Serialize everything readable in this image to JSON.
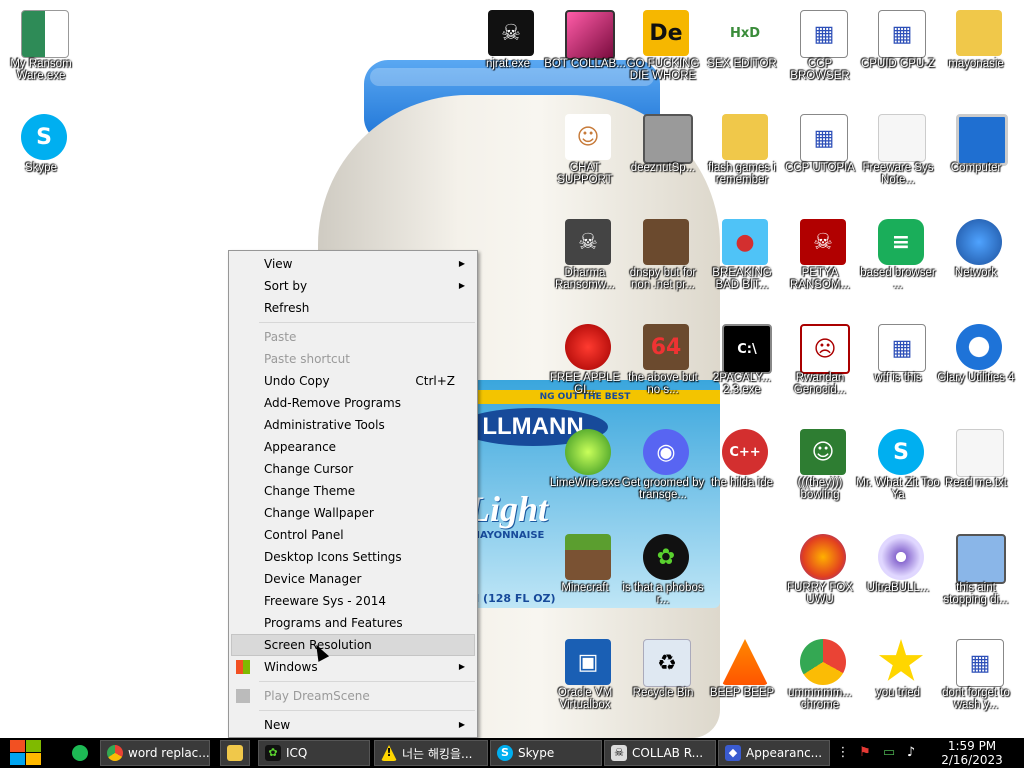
{
  "desktop": {
    "wallpaper": {
      "brand": "LLMANN",
      "band_text": "NG OUT THE BEST",
      "variant": "Light",
      "sub": "MAYONNAISE",
      "size": "N (128 FL OZ)"
    },
    "icons": [
      {
        "label": "My Ransom Ware.exe",
        "icon": "green-white-flag-icon"
      },
      {
        "label": "Skype",
        "icon": "skype-icon"
      },
      {
        "label": "njrat.exe",
        "icon": "skull-icon"
      },
      {
        "label": "BOT COLLAB...",
        "icon": "pink-monitor-icon"
      },
      {
        "label": "GO FUCKING DIE WHORE",
        "icon": "de-logo-icon"
      },
      {
        "label": "SEX EDITOR",
        "icon": "hxd-icon"
      },
      {
        "label": "CCP BROWSER",
        "icon": "document-icon"
      },
      {
        "label": "CPUID CPU-Z",
        "icon": "document-icon"
      },
      {
        "label": "mayonasie",
        "icon": "user-folder-icon"
      },
      {
        "label": "CHAT SUPPORT",
        "icon": "doctor-icon"
      },
      {
        "label": "deeznutSp...",
        "icon": "windows-stack-icon"
      },
      {
        "label": "flash games i remember",
        "icon": "folder-icon"
      },
      {
        "label": "CCP UTOPIA",
        "icon": "document-icon"
      },
      {
        "label": "Freeware Sys Note...",
        "icon": "blank-document-icon"
      },
      {
        "label": "Computer",
        "icon": "computer-icon"
      },
      {
        "label": "Dharma Ransomw...",
        "icon": "skull-helmet-icon"
      },
      {
        "label": "dnspy but for non .net pr...",
        "icon": "portrait-icon"
      },
      {
        "label": "BREAKING BAD BIT...",
        "icon": "angry-bird-icon"
      },
      {
        "label": "PETYA RANSOM...",
        "icon": "red-skull-icon"
      },
      {
        "label": "based browser ...",
        "icon": "green-chat-icon"
      },
      {
        "label": "Network",
        "icon": "network-globe-icon"
      },
      {
        "label": "FREE APPLE GI...",
        "icon": "apple-icon"
      },
      {
        "label": "the above but no s...",
        "icon": "portrait-64-icon"
      },
      {
        "label": "2PACALY... 2.3.exe",
        "icon": "terminal-icon"
      },
      {
        "label": "Rwandan Genocid...",
        "icon": "meme-face-icon"
      },
      {
        "label": "wtf is this",
        "icon": "document-icon"
      },
      {
        "label": "Glary Utilities 4",
        "icon": "glary-icon"
      },
      {
        "label": "LimeWire.exe",
        "icon": "limewire-icon"
      },
      {
        "label": "Get groomed by transge...",
        "icon": "discord-icon"
      },
      {
        "label": "the hilda ide",
        "icon": "devcpp-icon"
      },
      {
        "label": "(((they))) bowling",
        "icon": "santa-face-icon"
      },
      {
        "label": "Mr. What Zit Too Ya",
        "icon": "skype-icon"
      },
      {
        "label": "Read me.txt",
        "icon": "blank-document-icon"
      },
      {
        "label": "Minecraft",
        "icon": "grass-block-icon"
      },
      {
        "label": "is that a phobos r...",
        "icon": "icq-flower-icon"
      },
      {
        "label": "FURRY FOX UWU",
        "icon": "firefox-icon"
      },
      {
        "label": "UltraBULL...",
        "icon": "cd-icon"
      },
      {
        "label": "this aint stopping di...",
        "icon": "pc-tools-icon"
      },
      {
        "label": "Oracle VM Virtualbox",
        "icon": "virtualbox-icon"
      },
      {
        "label": "Recycle Bin",
        "icon": "recycle-bin-icon"
      },
      {
        "label": "BEEP BEEP",
        "icon": "vlc-cone-icon"
      },
      {
        "label": "ummmmm... chrome",
        "icon": "chrome-icon"
      },
      {
        "label": "you tried",
        "icon": "star-icon"
      },
      {
        "label": "dont forget to wash y...",
        "icon": "document-icon"
      }
    ]
  },
  "context_menu": {
    "items": [
      {
        "label": "View",
        "submenu": true,
        "enabled": true
      },
      {
        "label": "Sort by",
        "submenu": true,
        "enabled": true
      },
      {
        "label": "Refresh",
        "enabled": true
      },
      {
        "separator": true
      },
      {
        "label": "Paste",
        "enabled": false
      },
      {
        "label": "Paste shortcut",
        "enabled": false
      },
      {
        "label": "Undo Copy",
        "shortcut": "Ctrl+Z",
        "enabled": true
      },
      {
        "label": "Add-Remove Programs",
        "enabled": true
      },
      {
        "label": "Administrative Tools",
        "enabled": true
      },
      {
        "label": "Appearance",
        "enabled": true
      },
      {
        "label": "Change Cursor",
        "enabled": true
      },
      {
        "label": "Change Theme",
        "enabled": true
      },
      {
        "label": "Change Wallpaper",
        "enabled": true
      },
      {
        "label": "Control Panel",
        "enabled": true
      },
      {
        "label": "Desktop Icons Settings",
        "enabled": true
      },
      {
        "label": "Device Manager",
        "enabled": true
      },
      {
        "label": "Freeware Sys - 2014",
        "enabled": true
      },
      {
        "label": "Programs and Features",
        "enabled": true
      },
      {
        "label": "Screen Resolution",
        "enabled": true,
        "hovered": true
      },
      {
        "label": "Windows",
        "submenu": true,
        "enabled": true,
        "icon": "windows-flag-icon"
      },
      {
        "separator": true
      },
      {
        "label": "Play DreamScene",
        "enabled": false,
        "icon": "dreamscene-icon"
      },
      {
        "separator": true
      },
      {
        "label": "New",
        "submenu": true,
        "enabled": true
      }
    ]
  },
  "taskbar": {
    "start_icon": "windows-start-icon",
    "pinned": [
      {
        "icon": "spotify-icon"
      }
    ],
    "items": [
      {
        "label": "word replac...",
        "icon": "chrome-icon"
      },
      {
        "label": "",
        "icon": "folder-icon"
      },
      {
        "label": "ICQ",
        "icon": "icq-flower-icon"
      },
      {
        "label": "너는 해킹을...",
        "icon": "warning-icon"
      },
      {
        "label": "Skype",
        "icon": "skype-icon"
      },
      {
        "label": "COLLAB R...",
        "icon": "skull-icon"
      },
      {
        "label": "Appearanc...",
        "icon": "appearance-icon"
      }
    ],
    "tray": [
      {
        "icon": "more-icon"
      },
      {
        "icon": "red-flag-icon"
      },
      {
        "icon": "network-monitor-icon"
      },
      {
        "icon": "volume-icon"
      }
    ],
    "clock": {
      "time": "1:59 PM",
      "date": "2/16/2023"
    }
  }
}
